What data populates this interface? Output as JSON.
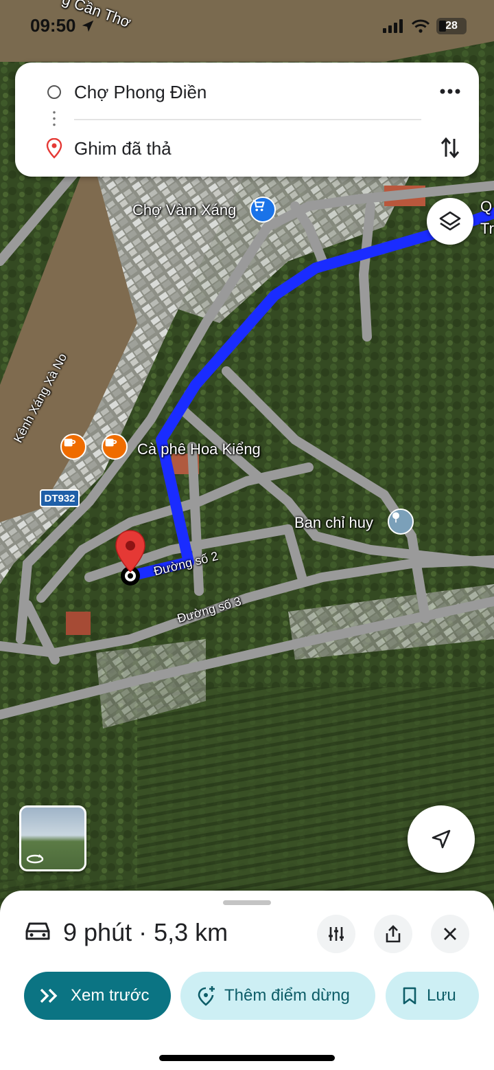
{
  "status_bar": {
    "time": "09:50",
    "battery": "28"
  },
  "route_card": {
    "origin": "Chợ Phong Điền",
    "destination": "Ghim đã thả"
  },
  "map": {
    "labels": {
      "top_river": "g Cần Thơ",
      "market": "Chợ Vàm Xáng",
      "canal": "Kênh Xáng Xà No",
      "cafe": "Cà phê Hoa Kiểng",
      "road_badge": "DT932",
      "command_post": "Ban chỉ huy",
      "road_2": "Đường số 2",
      "road_3": "Đường số 3",
      "edge_q": "Q",
      "edge_tr": "Tr"
    },
    "icons": {
      "market": "shopping-cart-icon",
      "cafe": "coffee-cup-icon",
      "command_post": "government-icon",
      "destination": "red-map-pin-icon"
    },
    "route_color": "#1a2cff"
  },
  "bottom_sheet": {
    "eta": "9 phút · 5,3 km",
    "preview_label": "Xem trước",
    "add_stop_label": "Thêm điểm dừng",
    "save_label": "Lưu"
  },
  "colors": {
    "primary_button": "#0b7483",
    "secondary_button": "#cdeff4",
    "pin": "#e53935"
  }
}
